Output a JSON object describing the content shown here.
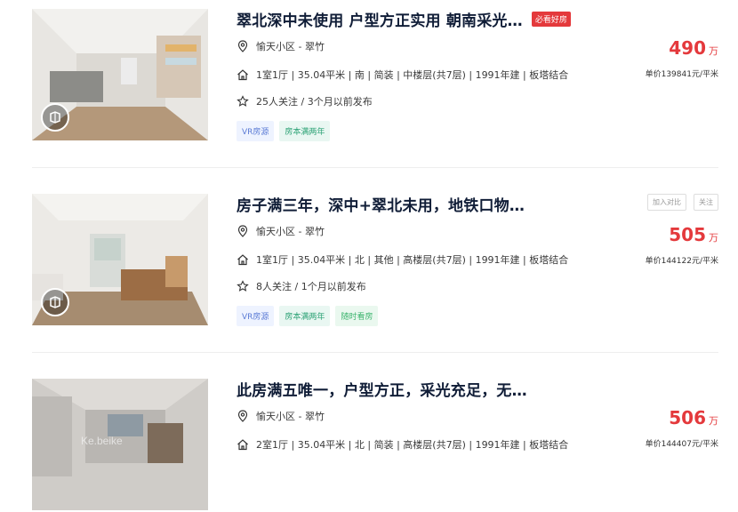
{
  "listings": [
    {
      "title": "翠北深中未使用 户型方正实用 朝南采光…",
      "hot_tag": "必看好房",
      "community": "愉天小区 - 翠竹",
      "info": "1室1厅 | 35.04平米 | 南 | 简装 | 中楼层(共7层) | 1991年建 | 板塔结合",
      "follow": "25人关注 / 3个月以前发布",
      "tags": [
        "VR房源",
        "房本满两年"
      ],
      "price": "490",
      "price_unit": "万",
      "unit_price": "单价139841元/平米"
    },
    {
      "title": "房子满三年，深中+翠北未用，地铁口物…",
      "actions": [
        "加入对比",
        "关注"
      ],
      "community": "愉天小区 - 翠竹",
      "info": "1室1厅 | 35.04平米 | 北 | 其他 | 高楼层(共7层) | 1991年建 | 板塔结合",
      "follow": "8人关注 / 1个月以前发布",
      "tags": [
        "VR房源",
        "房本满两年",
        "随时看房"
      ],
      "price": "505",
      "price_unit": "万",
      "unit_price": "单价144122元/平米"
    },
    {
      "title": "此房满五唯一，户型方正，采光充足，无…",
      "community": "愉天小区 - 翠竹",
      "info": "2室1厅 | 35.04平米 | 北 | 简装 | 高楼层(共7层) | 1991年建 | 板塔结合",
      "price": "506",
      "price_unit": "万",
      "unit_price": "单价144407元/平米",
      "watermark": "Ke.beike"
    }
  ],
  "colors": {
    "price": "#e4393c",
    "title": "#101d37"
  },
  "icons": [
    "location-icon",
    "home-icon",
    "star-icon",
    "vr-cube-icon"
  ]
}
